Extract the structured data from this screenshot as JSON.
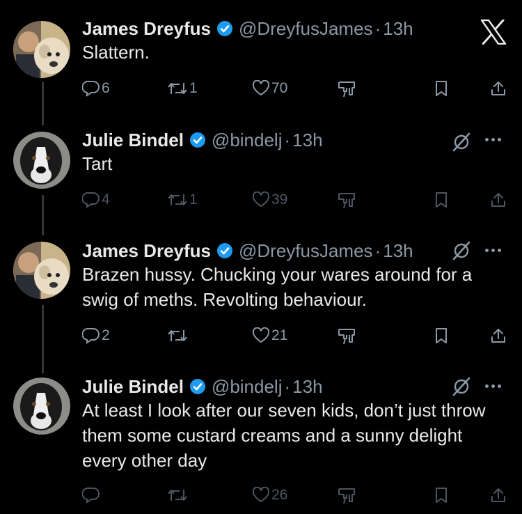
{
  "tweets": [
    {
      "name": "James Dreyfus",
      "handle": "@DreyfusJames",
      "dot": "·",
      "time": "13h",
      "text": "Slattern.",
      "replies": "6",
      "retweets": "1",
      "likes": "70",
      "avatar": "man-with-dog"
    },
    {
      "name": "Julie Bindel",
      "handle": "@bindelj",
      "dot": "·",
      "time": "13h",
      "text": "Tart",
      "replies": "4",
      "retweets": "1",
      "likes": "39",
      "avatar": "black-white-dog"
    },
    {
      "name": "James Dreyfus",
      "handle": "@DreyfusJames",
      "dot": "·",
      "time": "13h",
      "text": "Brazen hussy. Chucking your wares around for a swig of meths. Revolting behaviour.",
      "replies": "2",
      "retweets": "",
      "likes": "21",
      "avatar": "man-with-dog"
    },
    {
      "name": "Julie Bindel",
      "handle": "@bindelj",
      "dot": "·",
      "time": "13h",
      "text": "At least I look after our seven kids, don’t just throw them some custard creams and a sunny delight every other day",
      "replies": "",
      "retweets": "",
      "likes": "26",
      "avatar": "black-white-dog"
    }
  ],
  "icons": {
    "logo": "x-logo-icon",
    "verified": "verified-badge-icon",
    "grok": "grok-icon",
    "more": "more-icon",
    "reply": "reply-icon",
    "retweet": "retweet-icon",
    "like": "heart-icon",
    "views": "analytics-icon",
    "bookmark": "bookmark-icon",
    "share": "share-icon"
  },
  "colors": {
    "background": "#000000",
    "text": "#e7e9ea",
    "secondary": "#8b98a5",
    "verified": "#1d9bf0"
  }
}
